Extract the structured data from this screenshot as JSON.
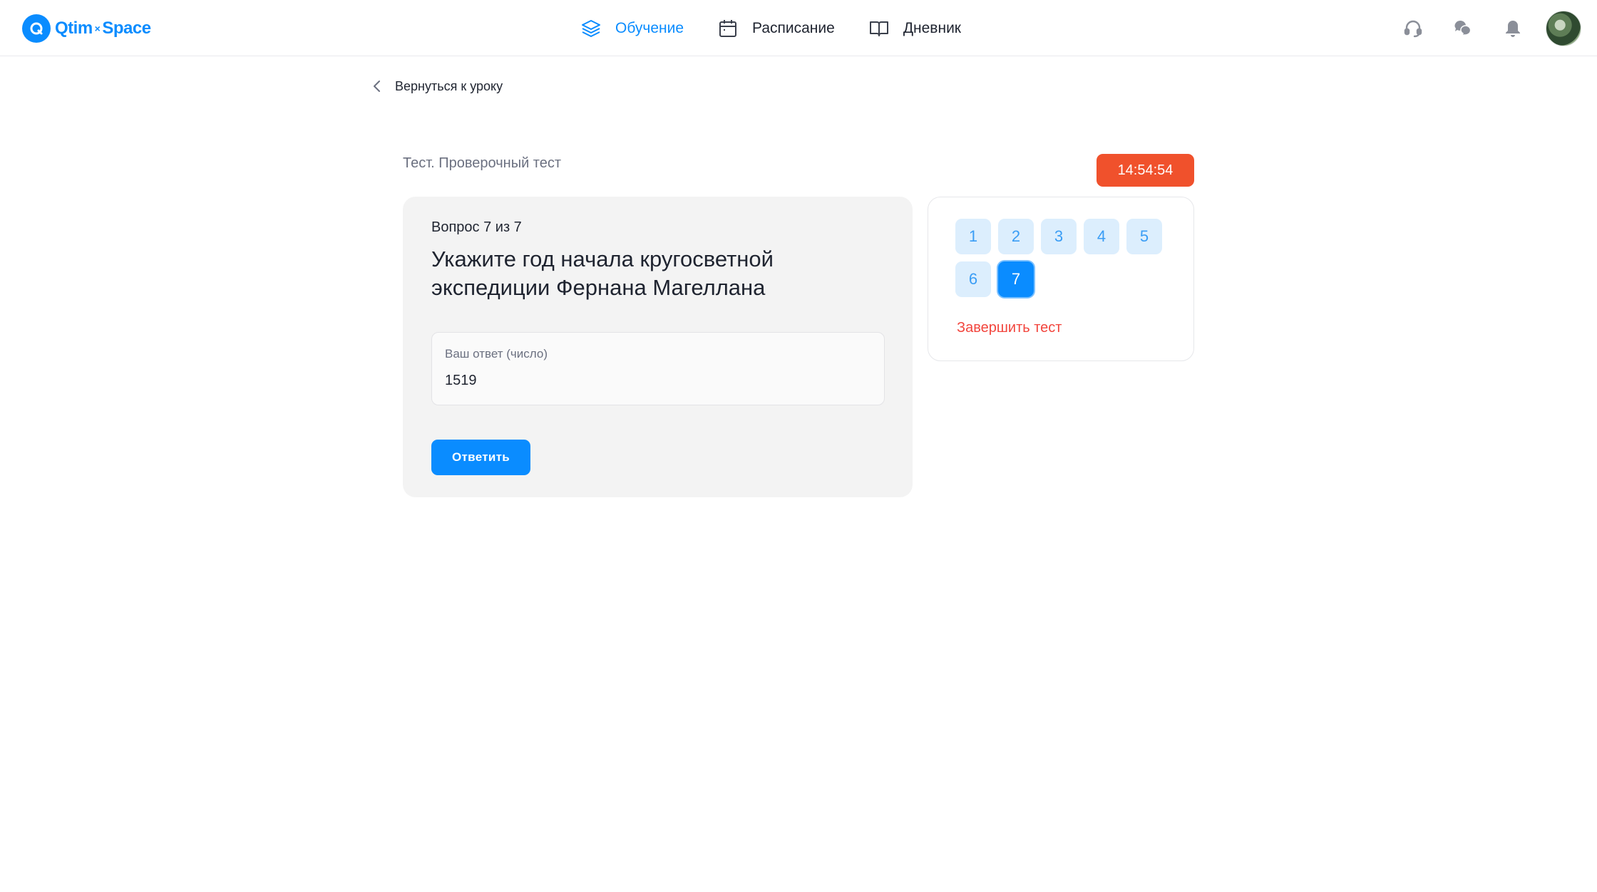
{
  "brand": {
    "name_left": "Qtim",
    "separator": "×",
    "name_right": "Space",
    "accent": "#0a8cff"
  },
  "nav": [
    {
      "label": "Обучение",
      "icon": "layers-icon",
      "active": true
    },
    {
      "label": "Расписание",
      "icon": "calendar-icon",
      "active": false
    },
    {
      "label": "Дневник",
      "icon": "book-icon",
      "active": false
    }
  ],
  "header_icons": [
    "headset-icon",
    "chat-icon",
    "bell-icon",
    "avatar"
  ],
  "back_link": "Вернуться к уроку",
  "test": {
    "title": "Тест. Проверочный тест",
    "timer": "14:54:54",
    "timer_color": "#f0512c"
  },
  "question": {
    "counter": "Вопрос 7 из 7",
    "text": "Укажите год начала кругосветной экспедиции Фернана Магеллана",
    "answer_label": "Ваш ответ (число)",
    "answer_value": "1519",
    "submit_label": "Ответить"
  },
  "question_nav": {
    "numbers": [
      "1",
      "2",
      "3",
      "4",
      "5",
      "6",
      "7"
    ],
    "current": "7",
    "finish_label": "Завершить тест",
    "finish_color": "#f2453d"
  }
}
